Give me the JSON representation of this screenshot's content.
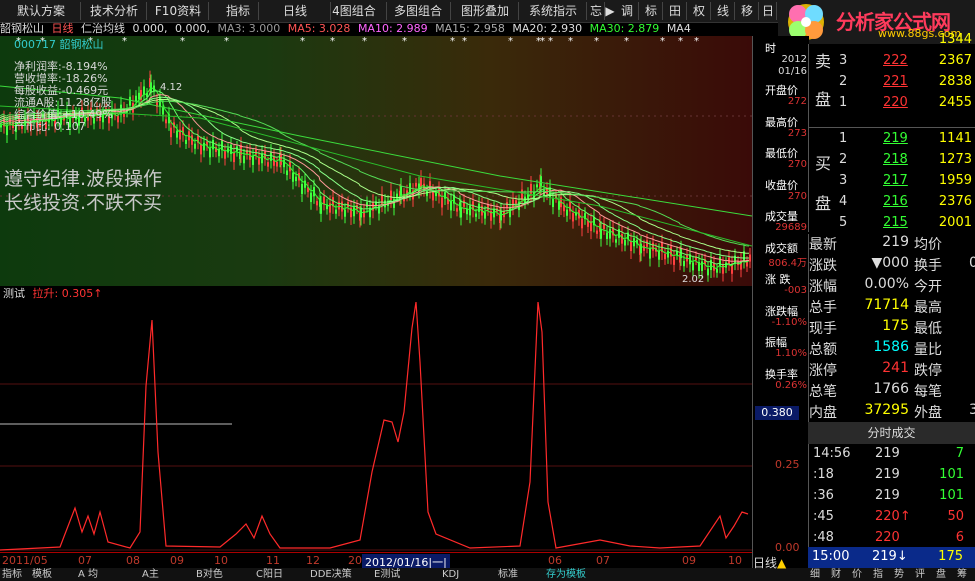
{
  "menubar": {
    "items": [
      "默认方案",
      "技术分析",
      "F10资料",
      "指标",
      "日线",
      "4图组合",
      "多图组合",
      "图形叠加",
      "系统指示",
      "忘",
      "调",
      "标",
      "田",
      "权",
      "线",
      "移",
      "日"
    ],
    "arrow_glyph": "▶"
  },
  "logo": {
    "text": "分析家公式网",
    "url": "www.88gs.com"
  },
  "infoline": {
    "stock": "韶钢松山",
    "period": "日线",
    "indicator": "仁治均线",
    "v1": "0.000,",
    "v2": "0.000,",
    "ma3": "MA3: 3.000",
    "ma5": "MA5: 3.028",
    "ma10": "MA10: 2.989",
    "ma15": "MA15: 2.958",
    "ma20": "MA20: 2.930",
    "ma30": "MA30: 2.879",
    "ma_last": "MA4"
  },
  "main": {
    "code_name": "000717 韶钢松山",
    "stats": [
      "净利润率:-8.194%",
      "营收增率:-18.26%",
      "每股收益:-0.469元",
      "流通A股:11.28亿股",
      "综合价值:+10.49%",
      "产市比: 0.107"
    ],
    "slogan1": "遵守纪律.波段操作",
    "slogan2": "长线投资.不跌不买",
    "high_label": "4.12",
    "low_label": "2.02"
  },
  "indicator": {
    "name": "测试",
    "label": "拉升: 0.305",
    "arrow": "↑"
  },
  "date_axis": {
    "ticks": [
      "2011/05",
      "07",
      "08",
      "09",
      "10",
      "11",
      "12",
      "2012",
      "",
      "",
      "06",
      "07",
      "09",
      "10"
    ],
    "highlight": "2012/01/16|一|"
  },
  "bottom_tabs": [
    "指标",
    "模板",
    "A 均",
    "A主",
    "B对色",
    "C阳日",
    "DDE决策",
    "E测试",
    "KDJ",
    "标准",
    "存为模板"
  ],
  "midcol": {
    "time_label": "时",
    "date": "2012",
    "date2": "01/16",
    "items": [
      {
        "label": "开盘价",
        "value": "272"
      },
      {
        "label": "最高价",
        "value": "273"
      },
      {
        "label": "最低价",
        "value": "270"
      },
      {
        "label": "收盘价",
        "value": "270"
      },
      {
        "label": "成交量",
        "value": "29689"
      },
      {
        "label": "成交额",
        "value": "806.4万"
      },
      {
        "label": "涨 跌",
        "value": "-003"
      },
      {
        "label": "涨跌幅",
        "value": "-1.10%"
      },
      {
        "label": "振幅",
        "value": "1.10%"
      },
      {
        "label": "换手率",
        "value": "0.26%"
      }
    ],
    "ind_value": "0.380",
    "axis_025": "0.25",
    "axis_000": "0.00",
    "period_btn": "日线"
  },
  "book": {
    "sell_label1": "卖",
    "sell_label2": "盘",
    "buy_label1": "买",
    "buy_label2": "盘",
    "sell": [
      {
        "lvl": "",
        "px": "",
        "vol": "1344"
      },
      {
        "lvl": "3",
        "px": "222",
        "vol": "2367"
      },
      {
        "lvl": "2",
        "px": "221",
        "vol": "2838"
      },
      {
        "lvl": "1",
        "px": "220",
        "vol": "2455"
      }
    ],
    "buy": [
      {
        "lvl": "1",
        "px": "219",
        "vol": "1141"
      },
      {
        "lvl": "2",
        "px": "218",
        "vol": "1273"
      },
      {
        "lvl": "3",
        "px": "217",
        "vol": "1959"
      },
      {
        "lvl": "4",
        "px": "216",
        "vol": "2376"
      },
      {
        "lvl": "5",
        "px": "215",
        "vol": "2001"
      }
    ]
  },
  "quote": {
    "rows": [
      {
        "l": "最新",
        "v": "219",
        "r": "均价",
        "rv": ""
      },
      {
        "l": "涨跌",
        "v": "▼000",
        "r": "换手",
        "rv": "0"
      },
      {
        "l": "涨幅",
        "v": "0.00%",
        "r": "今开",
        "rv": ""
      },
      {
        "l": "总手",
        "v": "71714",
        "r": "最高",
        "rv": ""
      },
      {
        "l": "现手",
        "v": "175",
        "r": "最低",
        "rv": ""
      },
      {
        "l": "总额",
        "v": "1586",
        "r": "量比",
        "rv": ""
      },
      {
        "l": "涨停",
        "v": "241",
        "r": "跌停",
        "rv": ""
      },
      {
        "l": "总笔",
        "v": "1766",
        "r": "每笔",
        "rv": ""
      },
      {
        "l": "内盘",
        "v": "37295",
        "r": "外盘",
        "rv": "3"
      }
    ]
  },
  "ticks": {
    "header": "分时成交",
    "rows": [
      {
        "time": "14:56",
        "px": "219",
        "vol": "7",
        "vcolor": "#3f3"
      },
      {
        "time": ":18",
        "px": "219",
        "vol": "101",
        "vcolor": "#3f3"
      },
      {
        "time": ":36",
        "px": "219",
        "vol": "101",
        "vcolor": "#3f3"
      },
      {
        "time": ":45",
        "px": "220↑",
        "vol": "50",
        "vcolor": "#f33"
      },
      {
        "time": ":48",
        "px": "220",
        "vol": "6",
        "vcolor": "#f33"
      }
    ],
    "last": {
      "time": "15:00",
      "px": "219↓",
      "vol": "175"
    }
  },
  "right_tabs": [
    "细",
    "财",
    "价",
    "指",
    "势",
    "评",
    "盘",
    "筹"
  ],
  "colors": {
    "red": "#ff3333",
    "green": "#33ff33",
    "yellow": "#ffff00",
    "cyan": "#00ffff"
  }
}
